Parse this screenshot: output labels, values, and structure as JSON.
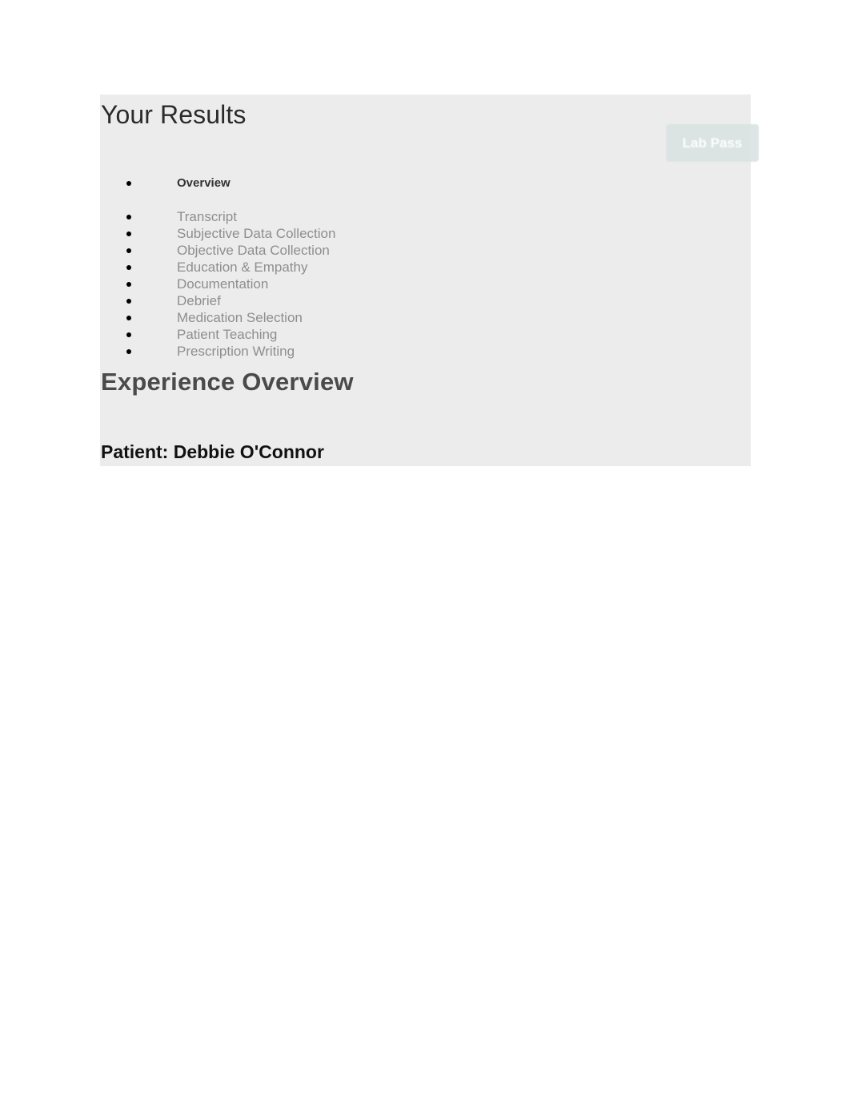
{
  "header": {
    "title": "Your Results",
    "lab_pass_label": "Lab Pass"
  },
  "nav": {
    "items": [
      {
        "label": "Overview",
        "active": true
      },
      {
        "label": "Transcript",
        "active": false
      },
      {
        "label": "Subjective Data Collection",
        "active": false
      },
      {
        "label": "Objective Data Collection",
        "active": false
      },
      {
        "label": "Education & Empathy",
        "active": false
      },
      {
        "label": "Documentation",
        "active": false
      },
      {
        "label": "Debrief",
        "active": false
      },
      {
        "label": "Medication Selection",
        "active": false
      },
      {
        "label": "Patient Teaching",
        "active": false
      },
      {
        "label": "Prescription Writing",
        "active": false
      }
    ]
  },
  "main": {
    "section_heading": "Experience Overview",
    "patient_line": "Patient: Debbie O'Connor"
  },
  "colors": {
    "panel_background": "#ececec",
    "page_background": "#ffffff",
    "lab_pass_background": "#dbe4e3",
    "lab_pass_text": "#ffffff",
    "title_text": "#2b2b2b",
    "nav_inactive_text": "#8e8e8e",
    "nav_active_text": "#333333",
    "section_heading_text": "#4a4a4a",
    "patient_text": "#111111"
  }
}
